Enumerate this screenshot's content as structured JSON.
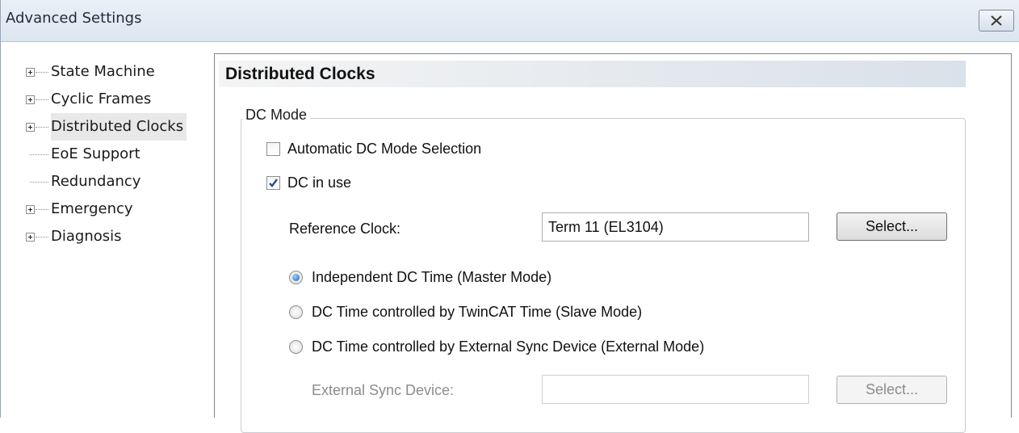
{
  "window": {
    "title": "Advanced Settings",
    "close_icon": "close-x-icon"
  },
  "tree": {
    "items": [
      {
        "label": "State Machine",
        "expandable": true
      },
      {
        "label": "Cyclic Frames",
        "expandable": true
      },
      {
        "label": "Distributed Clocks",
        "expandable": true,
        "selected": true
      },
      {
        "label": "EoE Support",
        "expandable": false
      },
      {
        "label": "Redundancy",
        "expandable": false
      },
      {
        "label": "Emergency",
        "expandable": true
      },
      {
        "label": "Diagnosis",
        "expandable": true
      }
    ]
  },
  "panel": {
    "title": "Distributed Clocks",
    "group_title": "DC Mode",
    "auto_dc_label": "Automatic DC Mode Selection",
    "auto_dc_checked": false,
    "dc_in_use_label": "DC in use",
    "dc_in_use_checked": true,
    "reference_clock_label": "Reference Clock:",
    "reference_clock_value": "Term 11 (EL3104)",
    "select_label": "Select...",
    "radio_options": [
      {
        "label": "Independent DC Time (Master Mode)",
        "selected": true
      },
      {
        "label": "DC Time controlled by TwinCAT Time (Slave Mode)",
        "selected": false
      },
      {
        "label": "DC Time controlled by External Sync Device (External Mode)",
        "selected": false
      }
    ],
    "external_sync_label": "External Sync Device:",
    "external_sync_value": "",
    "external_select_label": "Select..."
  },
  "colors": {
    "titlebar": "#dde6f0",
    "header_gradient_end": "#d9e1ea",
    "radio_accent": "#1e5fb0",
    "check_accent": "#2a4f8f"
  }
}
